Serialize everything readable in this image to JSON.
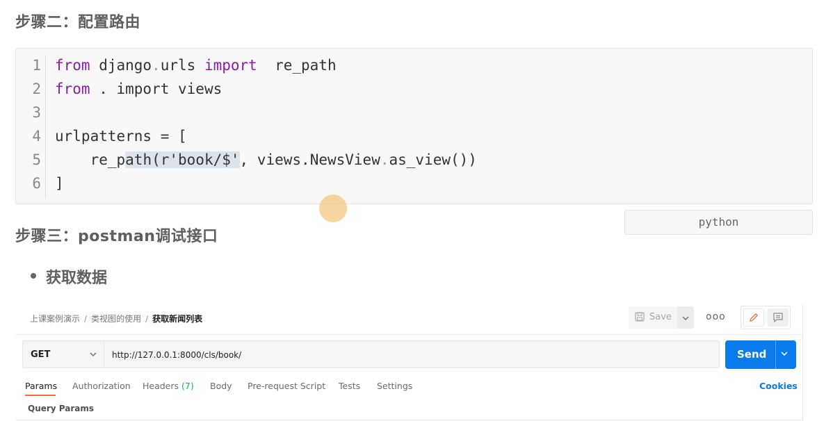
{
  "headings": {
    "step2": "步骤二：配置路由",
    "step3": "步骤三：postman调试接口"
  },
  "code": {
    "line_numbers": [
      "1",
      "2",
      "3",
      "4",
      "5",
      "6"
    ],
    "lines": [
      {
        "kw1": "from",
        "t1": " django",
        "op": ".",
        "t2": "urls ",
        "kw2": "import",
        "t3": "  re_path"
      },
      {
        "kw1": "from",
        "t1": " . import views"
      },
      {
        "t1": ""
      },
      {
        "t1": "urlpatterns = ["
      },
      {
        "t1": "    re_p",
        "hl": "ath(r'book/$'",
        "t2": ", views.",
        "t3": "NewsView",
        "op": ".",
        "t4": "as_view())"
      },
      {
        "t1": "]"
      }
    ],
    "language": "python"
  },
  "bullet": "获取数据",
  "postman": {
    "breadcrumb": [
      "上课案例演示",
      "类视图的使用",
      "获取新闻列表"
    ],
    "save_label": "Save",
    "more_label": "ooo",
    "method": "GET",
    "url": "http://127.0.0.1:8000/cls/book/",
    "send_label": "Send",
    "tabs": [
      {
        "label": "Params"
      },
      {
        "label": "Authorization"
      },
      {
        "label": "Headers",
        "count": "(7)"
      },
      {
        "label": "Body"
      },
      {
        "label": "Pre-request Script"
      },
      {
        "label": "Tests"
      },
      {
        "label": "Settings"
      }
    ],
    "cookies_label": "Cookies",
    "query_params_label": "Query Params"
  },
  "colors": {
    "accent_send": "#097bed",
    "keyword": "#8b1aa8",
    "active_tab_underline": "#f26b3a",
    "headers_count": "#0cbb52"
  }
}
